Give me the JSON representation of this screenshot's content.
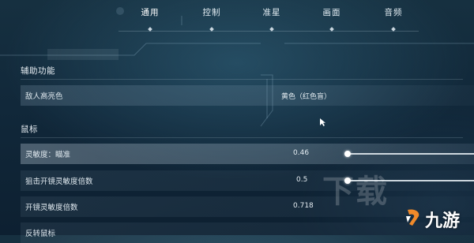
{
  "tabs": [
    {
      "label": "通用",
      "active": true
    },
    {
      "label": "控制",
      "active": false
    },
    {
      "label": "准星",
      "active": false
    },
    {
      "label": "画面",
      "active": false
    },
    {
      "label": "音频",
      "active": false
    }
  ],
  "sections": {
    "accessibility": {
      "title": "辅助功能",
      "rows": [
        {
          "label": "敌人高亮色",
          "value": "黄色（红色盲）"
        }
      ]
    },
    "mouse": {
      "title": "鼠标",
      "rows": [
        {
          "label": "灵敏度：瞄准",
          "value": "0.46",
          "slider_fraction": 0.46
        },
        {
          "label": "狙击开镜灵敏度倍数",
          "value": "0.5",
          "slider_fraction": 0.5
        },
        {
          "label": "开镜灵敏度倍数",
          "value": "0.718"
        },
        {
          "label": "反转鼠标",
          "value": ""
        }
      ]
    }
  },
  "watermark": {
    "big_text": "下载",
    "logo_text": "九游"
  },
  "colors": {
    "background": "#12293a",
    "accent_white": "#ffffff",
    "logo_orange": "#f08a2a"
  }
}
